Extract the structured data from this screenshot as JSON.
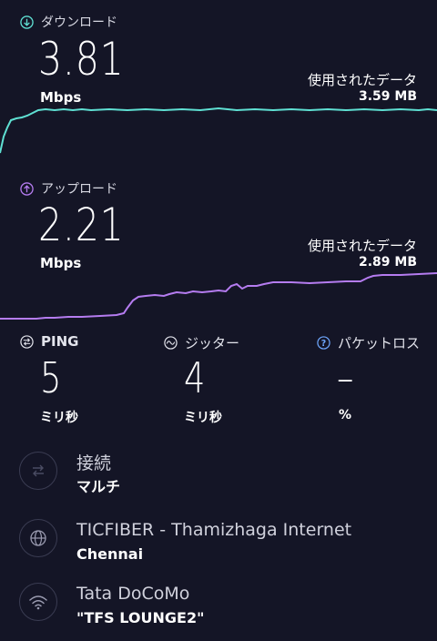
{
  "download": {
    "label": "ダウンロード",
    "value": "3.81",
    "unit": "Mbps",
    "used_label": "使用されたデータ",
    "used_value": "3.59 MB",
    "color": "#5fe0d3"
  },
  "upload": {
    "label": "アップロード",
    "value": "2.21",
    "unit": "Mbps",
    "used_label": "使用されたデータ",
    "used_value": "2.89 MB",
    "color": "#b57cf0"
  },
  "metrics": {
    "ping": {
      "label": "PING",
      "value": "5",
      "unit": "ミリ秒"
    },
    "jitter": {
      "label": "ジッター",
      "value": "4",
      "unit": "ミリ秒"
    },
    "packet_loss": {
      "label": "パケットロス",
      "value": "–",
      "unit": "%"
    }
  },
  "connection": {
    "title": "接続",
    "value": "マルチ",
    "icon": "connection-arrows-icon"
  },
  "isp": {
    "title": "TICFIBER - Thamizhaga Internet",
    "location": "Chennai",
    "icon": "globe-icon"
  },
  "network": {
    "title": "Tata DoCoMo",
    "ssid": "\"TFS LOUNGE2\"",
    "icon": "wifi-icon"
  }
}
